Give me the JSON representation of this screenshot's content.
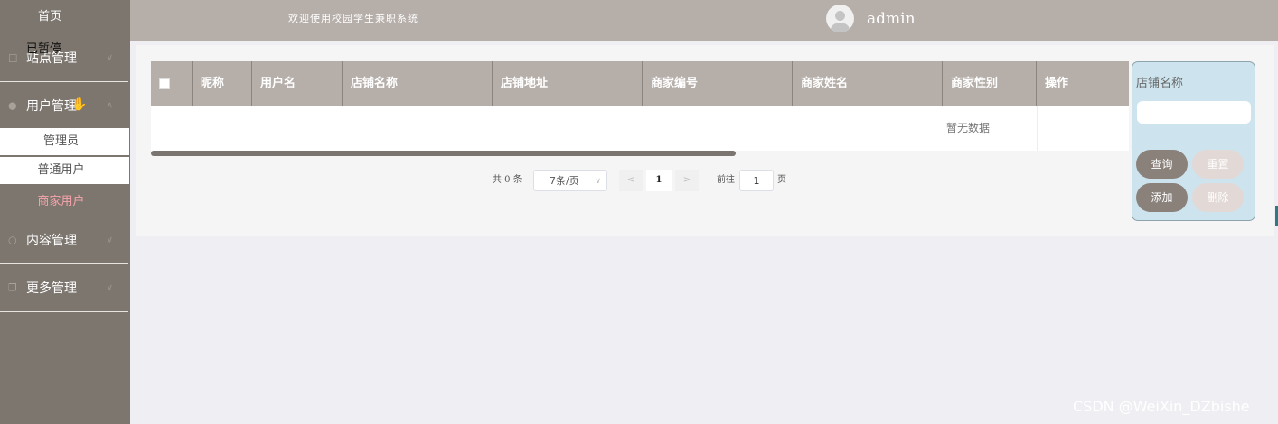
{
  "sidebar": {
    "home": "首页",
    "paused": "已暂停",
    "menus": [
      {
        "label": "站点管理",
        "icon": "monitor-icon"
      },
      {
        "label": "用户管理",
        "icon": "user-icon"
      },
      {
        "label": "内容管理",
        "icon": "chat-icon"
      },
      {
        "label": "更多管理",
        "icon": "copy-icon"
      }
    ],
    "sub_items": [
      "管理员",
      "普通用户",
      "商家用户"
    ]
  },
  "header": {
    "welcome": "欢迎使用校园学生兼职系统",
    "username": "admin"
  },
  "table": {
    "columns": [
      "昵称",
      "用户名",
      "店铺名称",
      "店铺地址",
      "商家编号",
      "商家姓名",
      "商家性别",
      "操作"
    ],
    "empty_text": "暂无数据"
  },
  "pagination": {
    "total": "共 0 条",
    "page_size": "7条/页",
    "current_page": "1",
    "goto_label": "前往",
    "goto_value": "1",
    "page_suffix": "页"
  },
  "search": {
    "field_label": "店铺名称",
    "query": "查询",
    "reset": "重置",
    "add": "添加",
    "delete": "删除"
  },
  "watermark": "CSDN @WeiXin_DZbishe",
  "colors": {
    "sidebar_bg": "#7d766f",
    "header_bg": "#b5aea9",
    "active_sub": "#f7a4ab",
    "search_panel_bg": "#cde4ee"
  }
}
